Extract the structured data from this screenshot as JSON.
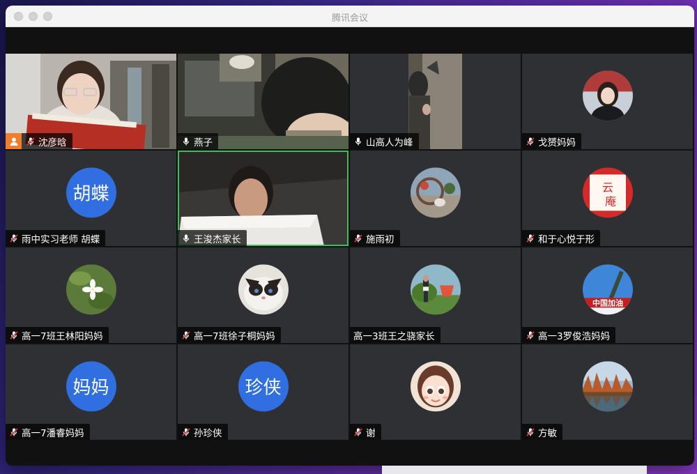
{
  "window": {
    "title": "腾讯会议"
  },
  "participants": [
    {
      "name": "沈彦晗",
      "muted": true,
      "host": true,
      "type": "video"
    },
    {
      "name": "燕子",
      "muted": false,
      "type": "video"
    },
    {
      "name": "山高人为峰",
      "muted": false,
      "type": "video"
    },
    {
      "name": "戈赟妈妈",
      "muted": true,
      "type": "photo"
    },
    {
      "name": "雨中实习老师 胡蝶",
      "muted": true,
      "type": "text",
      "avatar_text": "胡蝶"
    },
    {
      "name": "王浚杰家长",
      "muted": false,
      "type": "video",
      "active": true
    },
    {
      "name": "施雨初",
      "muted": true,
      "type": "photo"
    },
    {
      "name": "和于心悦于形",
      "muted": true,
      "type": "photo"
    },
    {
      "name": "高一7班王林阳妈妈",
      "muted": true,
      "type": "photo"
    },
    {
      "name": "高一7班徐子桐妈妈",
      "muted": true,
      "type": "photo"
    },
    {
      "name": "高一3班王之骁家长",
      "muted": false,
      "type": "photo"
    },
    {
      "name": "高一3罗俊浩妈妈",
      "muted": true,
      "type": "photo"
    },
    {
      "name": "高一7潘睿妈妈",
      "muted": true,
      "type": "text",
      "avatar_text": "妈妈"
    },
    {
      "name": "孙珍侠",
      "muted": true,
      "type": "text",
      "avatar_text": "珍侠"
    },
    {
      "name": "谢",
      "muted": true,
      "type": "photo"
    },
    {
      "name": "方敏",
      "muted": true,
      "type": "photo"
    }
  ],
  "avatar_photos": {
    "p4": "中国加油"
  },
  "colors": {
    "accent": "#2f6fe0",
    "active_border": "#3fbf5a",
    "host_badge": "#f07d2a",
    "muted_red": "#e04040"
  }
}
